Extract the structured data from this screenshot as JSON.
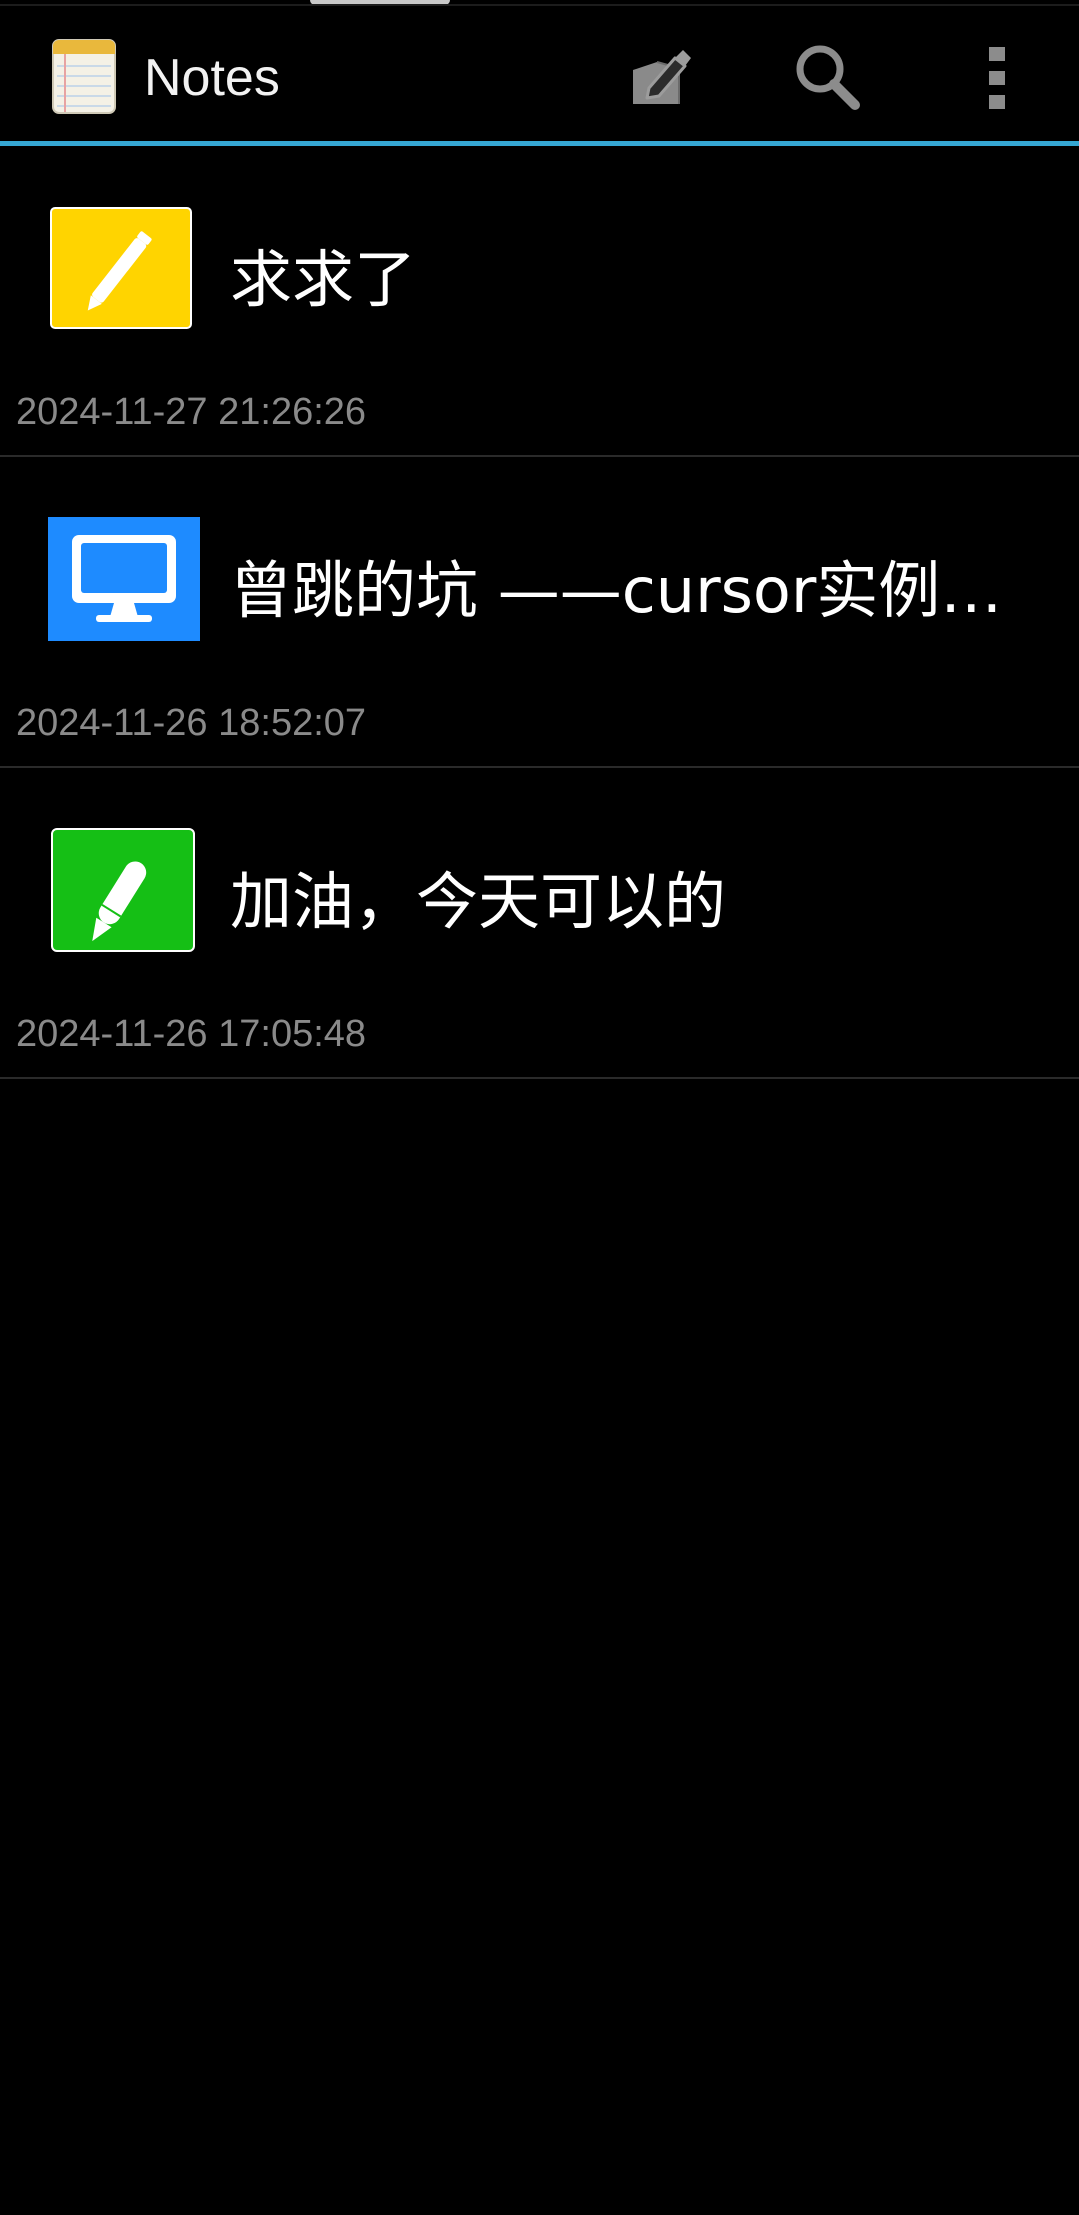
{
  "app": {
    "title": "Notes",
    "icon": "notepad-icon"
  },
  "toolbar": {
    "new_note_icon": "new-note-icon",
    "search_icon": "search-icon",
    "overflow_icon": "overflow-menu-icon"
  },
  "colors": {
    "background": "#000000",
    "accent": "#35a7d3",
    "timestamp": "#8a8a8a",
    "divider": "#2a2a2a"
  },
  "notes": [
    {
      "title": "求求了",
      "timestamp": "2024-11-27 21:26:26",
      "icon": "yellow-pencil-icon",
      "icon_color": "#ffd400"
    },
    {
      "title": "曾跳的坑 ——cursor实例…",
      "timestamp": "2024-11-26 18:52:07",
      "icon": "blue-monitor-icon",
      "icon_color": "#1e8bff"
    },
    {
      "title": "加油，今天可以的",
      "timestamp": "2024-11-26 17:05:48",
      "icon": "green-pencil-icon",
      "icon_color": "#15bf15"
    }
  ]
}
